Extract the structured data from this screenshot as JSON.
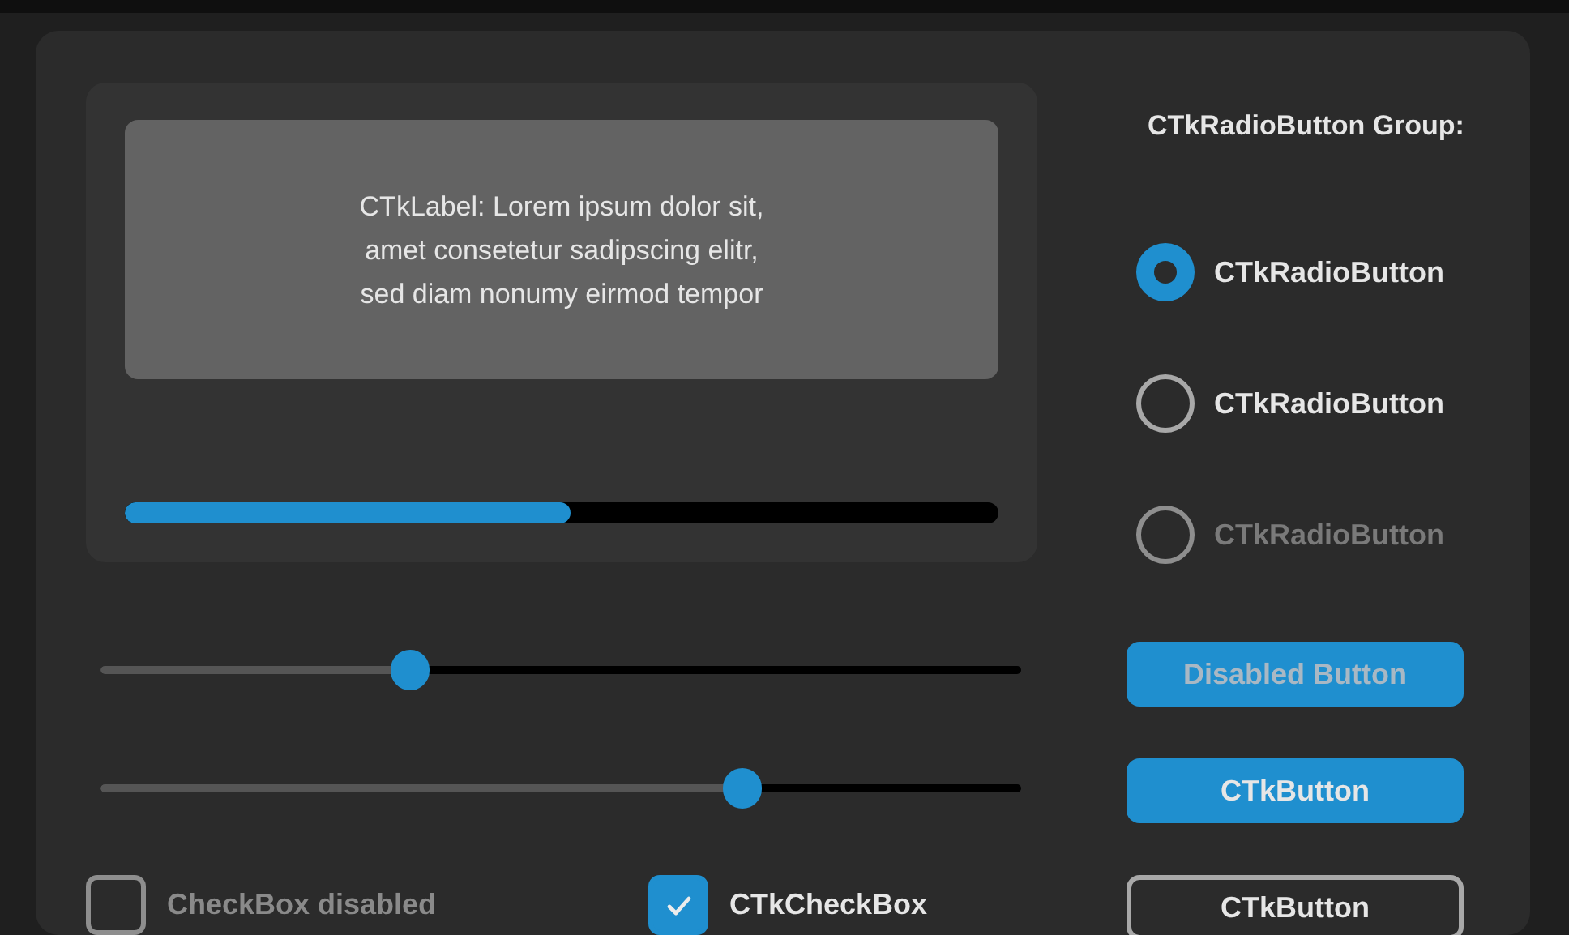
{
  "label": {
    "text": "CTkLabel: Lorem ipsum dolor sit,\namet consetetur sadipscing elitr,\nsed diam nonumy eirmod tempor"
  },
  "progress": {
    "level": 0.51
  },
  "sliders": [
    {
      "level": 0.336
    },
    {
      "level": 0.697
    }
  ],
  "checkboxes": [
    {
      "label": "CheckBox disabled",
      "checked": false,
      "disabled": true
    },
    {
      "label": "CTkCheckBox",
      "checked": true,
      "disabled": false
    }
  ],
  "radio_group": {
    "title": "CTkRadioButton Group:",
    "radios": [
      {
        "label": "CTkRadioButton",
        "selected": true,
        "disabled": false
      },
      {
        "label": "CTkRadioButton",
        "selected": false,
        "disabled": false
      },
      {
        "label": "CTkRadioButton",
        "selected": false,
        "disabled": true
      }
    ]
  },
  "buttons": [
    {
      "label": "Disabled Button",
      "kind": "filled",
      "disabled": true
    },
    {
      "label": "CTkButton",
      "kind": "filled",
      "disabled": false
    },
    {
      "label": "CTkButton",
      "kind": "outline",
      "disabled": false
    }
  ]
}
